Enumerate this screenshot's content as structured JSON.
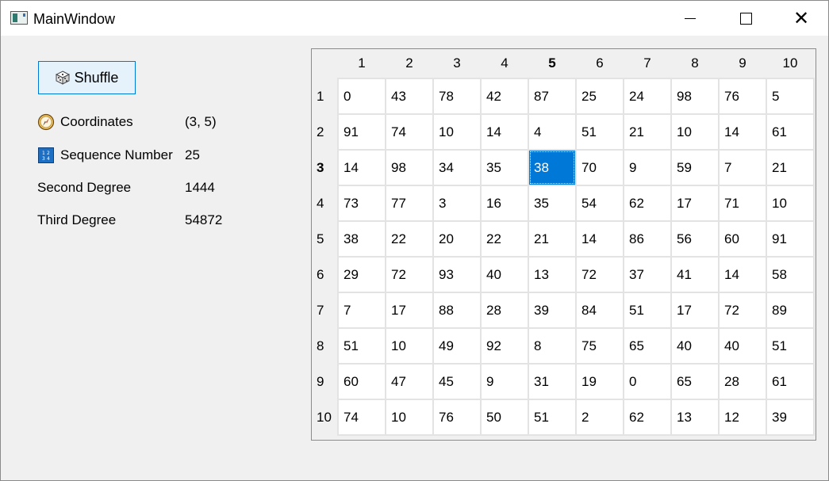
{
  "window": {
    "title": "MainWindow"
  },
  "controls": {
    "shuffle_label": "Shuffle"
  },
  "info": {
    "coordinates": {
      "label": "Coordinates",
      "value": "(3, 5)"
    },
    "sequence": {
      "label": "Sequence Number",
      "value": "25"
    },
    "second": {
      "label": "Second Degree",
      "value": "1444"
    },
    "third": {
      "label": "Third Degree",
      "value": "54872"
    }
  },
  "grid": {
    "column_headers": [
      "1",
      "2",
      "3",
      "4",
      "5",
      "6",
      "7",
      "8",
      "9",
      "10"
    ],
    "row_headers": [
      "1",
      "2",
      "3",
      "4",
      "5",
      "6",
      "7",
      "8",
      "9",
      "10"
    ],
    "selected_row": 3,
    "selected_col": 5,
    "selected_color": "#0078d7",
    "rows": [
      [
        "0",
        "43",
        "78",
        "42",
        "87",
        "25",
        "24",
        "98",
        "76",
        "5"
      ],
      [
        "91",
        "74",
        "10",
        "14",
        "4",
        "51",
        "21",
        "10",
        "14",
        "61"
      ],
      [
        "14",
        "98",
        "34",
        "35",
        "38",
        "70",
        "9",
        "59",
        "7",
        "21"
      ],
      [
        "73",
        "77",
        "3",
        "16",
        "35",
        "54",
        "62",
        "17",
        "71",
        "10"
      ],
      [
        "38",
        "22",
        "20",
        "22",
        "21",
        "14",
        "86",
        "56",
        "60",
        "91"
      ],
      [
        "29",
        "72",
        "93",
        "40",
        "13",
        "72",
        "37",
        "41",
        "14",
        "58"
      ],
      [
        "7",
        "17",
        "88",
        "28",
        "39",
        "84",
        "51",
        "17",
        "72",
        "89"
      ],
      [
        "51",
        "10",
        "49",
        "92",
        "8",
        "75",
        "65",
        "40",
        "40",
        "51"
      ],
      [
        "60",
        "47",
        "45",
        "9",
        "31",
        "19",
        "0",
        "65",
        "28",
        "61"
      ],
      [
        "74",
        "10",
        "76",
        "50",
        "51",
        "2",
        "62",
        "13",
        "12",
        "39"
      ]
    ]
  },
  "icons": {
    "app": "app-window-icon",
    "shuffle": "dice-icon",
    "coordinates": "compass-icon",
    "sequence": "number-grid-icon"
  }
}
